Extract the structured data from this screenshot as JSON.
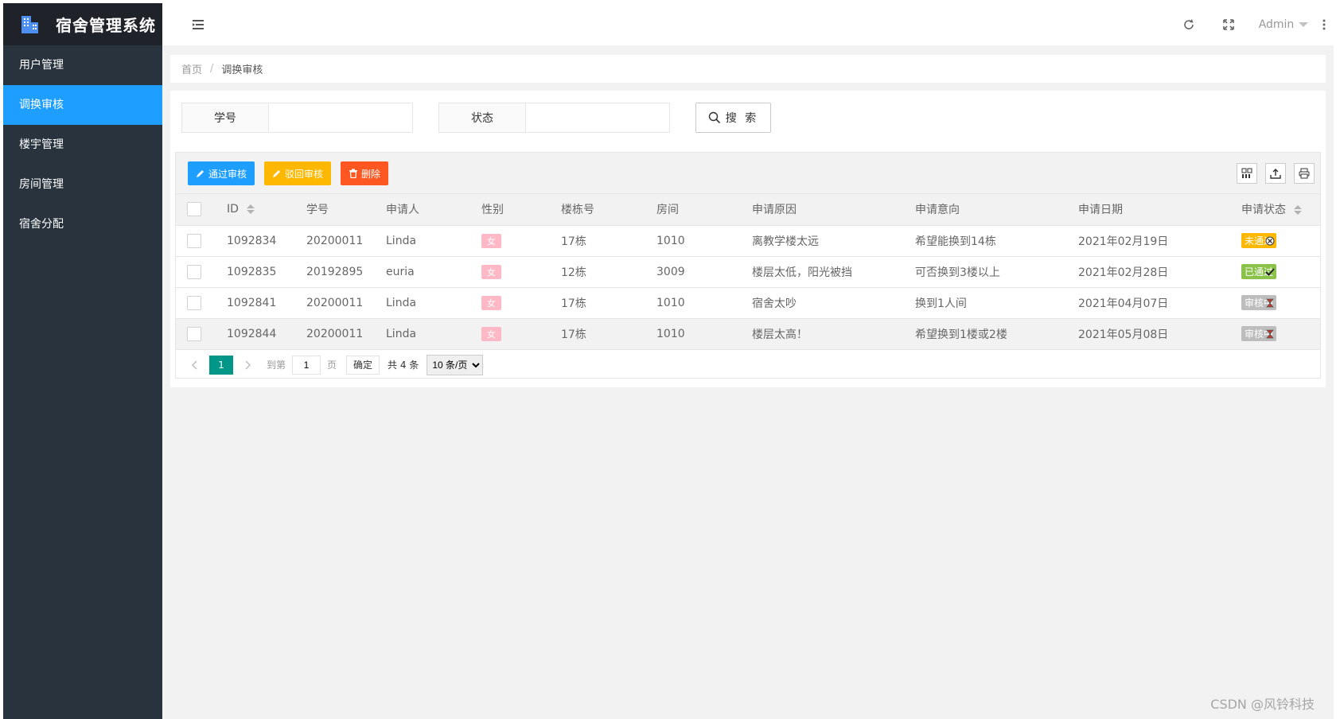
{
  "app": {
    "title": "宿舍管理系统"
  },
  "sidebar": {
    "items": [
      {
        "label": "用户管理"
      },
      {
        "label": "调换审核",
        "active": true
      },
      {
        "label": "楼宇管理"
      },
      {
        "label": "房间管理"
      },
      {
        "label": "宿舍分配"
      }
    ]
  },
  "header": {
    "user": "Admin"
  },
  "breadcrumb": {
    "home": "首页",
    "separator": "/",
    "current": "调换审核"
  },
  "search": {
    "student_no_label": "学号",
    "student_no_value": "",
    "status_label": "状态",
    "status_value": "",
    "button_label": "搜 索"
  },
  "toolbar": {
    "approve_label": "通过审核",
    "reject_label": "驳回审核",
    "delete_label": "删除",
    "colors": {
      "approve": "#1e9fff",
      "reject": "#ffb800",
      "delete": "#ff5722"
    }
  },
  "table": {
    "headers": [
      "ID",
      "学号",
      "申请人",
      "性别",
      "楼栋号",
      "房间",
      "申请原因",
      "申请意向",
      "申请日期",
      "申请状态"
    ],
    "rows": [
      {
        "id": "1092834",
        "student_no": "20200011",
        "name": "Linda",
        "gender": "女",
        "building": "17栋",
        "room": "1010",
        "reason": "离教学楼太远",
        "intent": "希望能换到14栋",
        "date": "2021年02月19日",
        "status": "未通过",
        "status_color": "#ffb800",
        "status_icon": "failed-icon"
      },
      {
        "id": "1092835",
        "student_no": "20192895",
        "name": "euria",
        "gender": "女",
        "building": "12栋",
        "room": "3009",
        "reason": "楼层太低，阳光被挡",
        "intent": "可否换到3楼以上",
        "date": "2021年02月28日",
        "status": "已通过",
        "status_color": "#8bc34a",
        "status_icon": "passed-icon"
      },
      {
        "id": "1092841",
        "student_no": "20200011",
        "name": "Linda",
        "gender": "女",
        "building": "17栋",
        "room": "1010",
        "reason": "宿舍太吵",
        "intent": "换到1人间",
        "date": "2021年04月07日",
        "status": "审核中",
        "status_color": "#bdbdbd",
        "status_icon": "hourglass-icon"
      },
      {
        "id": "1092844",
        "student_no": "20200011",
        "name": "Linda",
        "gender": "女",
        "building": "17栋",
        "room": "1010",
        "reason": "楼层太高！",
        "intent": "希望换到1楼或2楼",
        "date": "2021年05月08日",
        "status": "审核中",
        "status_color": "#bdbdbd",
        "status_icon": "hourglass-icon"
      }
    ]
  },
  "pager": {
    "current_page": "1",
    "goto_label": "到第",
    "goto_value": "1",
    "page_label": "页",
    "confirm_label": "确定",
    "total_label": "共 4 条",
    "page_size": "10 条/页"
  },
  "watermark": "CSDN @风铃科技"
}
